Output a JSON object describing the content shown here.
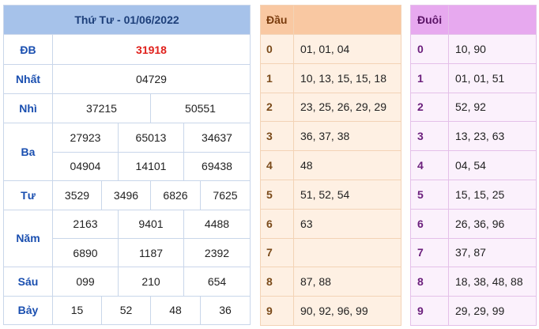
{
  "results": {
    "header": "Thứ Tư - 01/06/2022",
    "prizes": {
      "db": {
        "label": "ĐB",
        "numbers": [
          "31918"
        ]
      },
      "nhat": {
        "label": "Nhất",
        "numbers": [
          "04729"
        ]
      },
      "nhi": {
        "label": "Nhì",
        "numbers": [
          "37215",
          "50551"
        ]
      },
      "ba": {
        "label": "Ba",
        "numbers": [
          "27923",
          "65013",
          "34637",
          "04904",
          "14101",
          "69438"
        ]
      },
      "tu": {
        "label": "Tư",
        "numbers": [
          "3529",
          "3496",
          "6826",
          "7625"
        ]
      },
      "nam": {
        "label": "Năm",
        "numbers": [
          "2163",
          "9401",
          "4488",
          "6890",
          "1187",
          "2392"
        ]
      },
      "sau": {
        "label": "Sáu",
        "numbers": [
          "099",
          "210",
          "654"
        ]
      },
      "bay": {
        "label": "Bảy",
        "numbers": [
          "15",
          "52",
          "48",
          "36"
        ]
      }
    }
  },
  "dau": {
    "header": "Đầu",
    "rows": [
      {
        "key": "0",
        "value": "01, 01, 04"
      },
      {
        "key": "1",
        "value": "10, 13, 15, 15, 18"
      },
      {
        "key": "2",
        "value": "23, 25, 26, 29, 29"
      },
      {
        "key": "3",
        "value": "36, 37, 38"
      },
      {
        "key": "4",
        "value": "48"
      },
      {
        "key": "5",
        "value": "51, 52, 54"
      },
      {
        "key": "6",
        "value": "63"
      },
      {
        "key": "7",
        "value": ""
      },
      {
        "key": "8",
        "value": "87, 88"
      },
      {
        "key": "9",
        "value": "90, 92, 96, 99"
      }
    ]
  },
  "duoi": {
    "header": "Đuôi",
    "rows": [
      {
        "key": "0",
        "value": "10, 90"
      },
      {
        "key": "1",
        "value": "01, 01, 51"
      },
      {
        "key": "2",
        "value": "52, 92"
      },
      {
        "key": "3",
        "value": "13, 23, 63"
      },
      {
        "key": "4",
        "value": "04, 54"
      },
      {
        "key": "5",
        "value": "15, 15, 25"
      },
      {
        "key": "6",
        "value": "26, 36, 96"
      },
      {
        "key": "7",
        "value": "37, 87"
      },
      {
        "key": "8",
        "value": "18, 38, 48, 88"
      },
      {
        "key": "9",
        "value": "29, 29, 99"
      }
    ]
  }
}
